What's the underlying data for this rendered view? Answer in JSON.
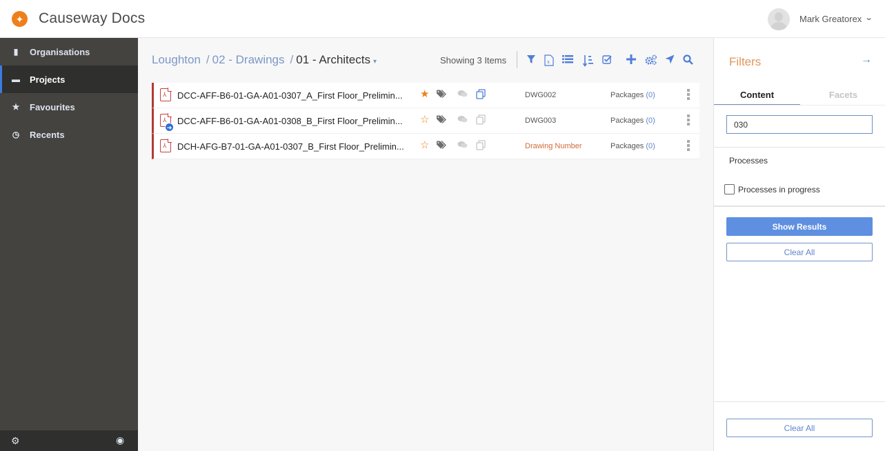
{
  "app": {
    "title": "Causeway Docs",
    "logo_icon": "causeway-star-logo"
  },
  "user": {
    "name": "Mark Greatorex",
    "menu_icon": "chevron-down-icon"
  },
  "sidebar": {
    "items": [
      {
        "label": "Organisations",
        "icon": "building-icon",
        "active": false
      },
      {
        "label": "Projects",
        "icon": "briefcase-icon",
        "active": true
      },
      {
        "label": "Favourites",
        "icon": "star-icon",
        "active": false
      },
      {
        "label": "Recents",
        "icon": "clock-icon",
        "active": false
      }
    ],
    "footer": {
      "settings_icon": "gear-icon",
      "visibility_icon": "eye-slash-icon"
    }
  },
  "breadcrumb": {
    "items": [
      "Loughton",
      "02 - Drawings"
    ],
    "separator": "/",
    "current": "01 - Architects"
  },
  "toolbar": {
    "showing_text": "Showing 3 Items",
    "tools": [
      "filter-icon",
      "export-excel-icon",
      "list-view-icon",
      "sort-icon",
      "select-icon",
      "add-icon",
      "settings-icon",
      "navigate-icon",
      "search-icon"
    ]
  },
  "documents": [
    {
      "name": "DCC-AFF-B6-01-GA-A01-0307_A_First Floor_Prelimin...",
      "favourite": true,
      "has_process_badge": false,
      "copy_active": true,
      "drawing_number": "DWG002",
      "drawing_number_is_placeholder": false,
      "packages_label": "Packages",
      "packages_count": "(0)"
    },
    {
      "name": "DCC-AFF-B6-01-GA-A01-0308_B_First Floor_Prelimin...",
      "favourite": false,
      "has_process_badge": true,
      "copy_active": false,
      "drawing_number": "DWG003",
      "drawing_number_is_placeholder": false,
      "packages_label": "Packages",
      "packages_count": "(0)"
    },
    {
      "name": "DCH-AFG-B7-01-GA-A01-0307_B_First Floor_Prelimin...",
      "favourite": false,
      "has_process_badge": false,
      "copy_active": false,
      "drawing_number": "Drawing Number",
      "drawing_number_is_placeholder": true,
      "packages_label": "Packages",
      "packages_count": "(0)"
    }
  ],
  "filters": {
    "title": "Filters",
    "close_icon": "arrow-right-icon",
    "tabs": [
      {
        "label": "Content",
        "active": true
      },
      {
        "label": "Facets",
        "active": false
      }
    ],
    "search_value": "030",
    "processes": {
      "title": "Processes",
      "checkbox_label": "Processes in progress",
      "checked": false
    },
    "show_results_label": "Show Results",
    "clear_all_label": "Clear All",
    "footer_clear_all_label": "Clear All"
  },
  "colors": {
    "brand_orange": "#ef7f1a",
    "accent_blue": "#4f7ed8",
    "sidebar_bg": "#444340",
    "row_marker": "#b13a34"
  }
}
